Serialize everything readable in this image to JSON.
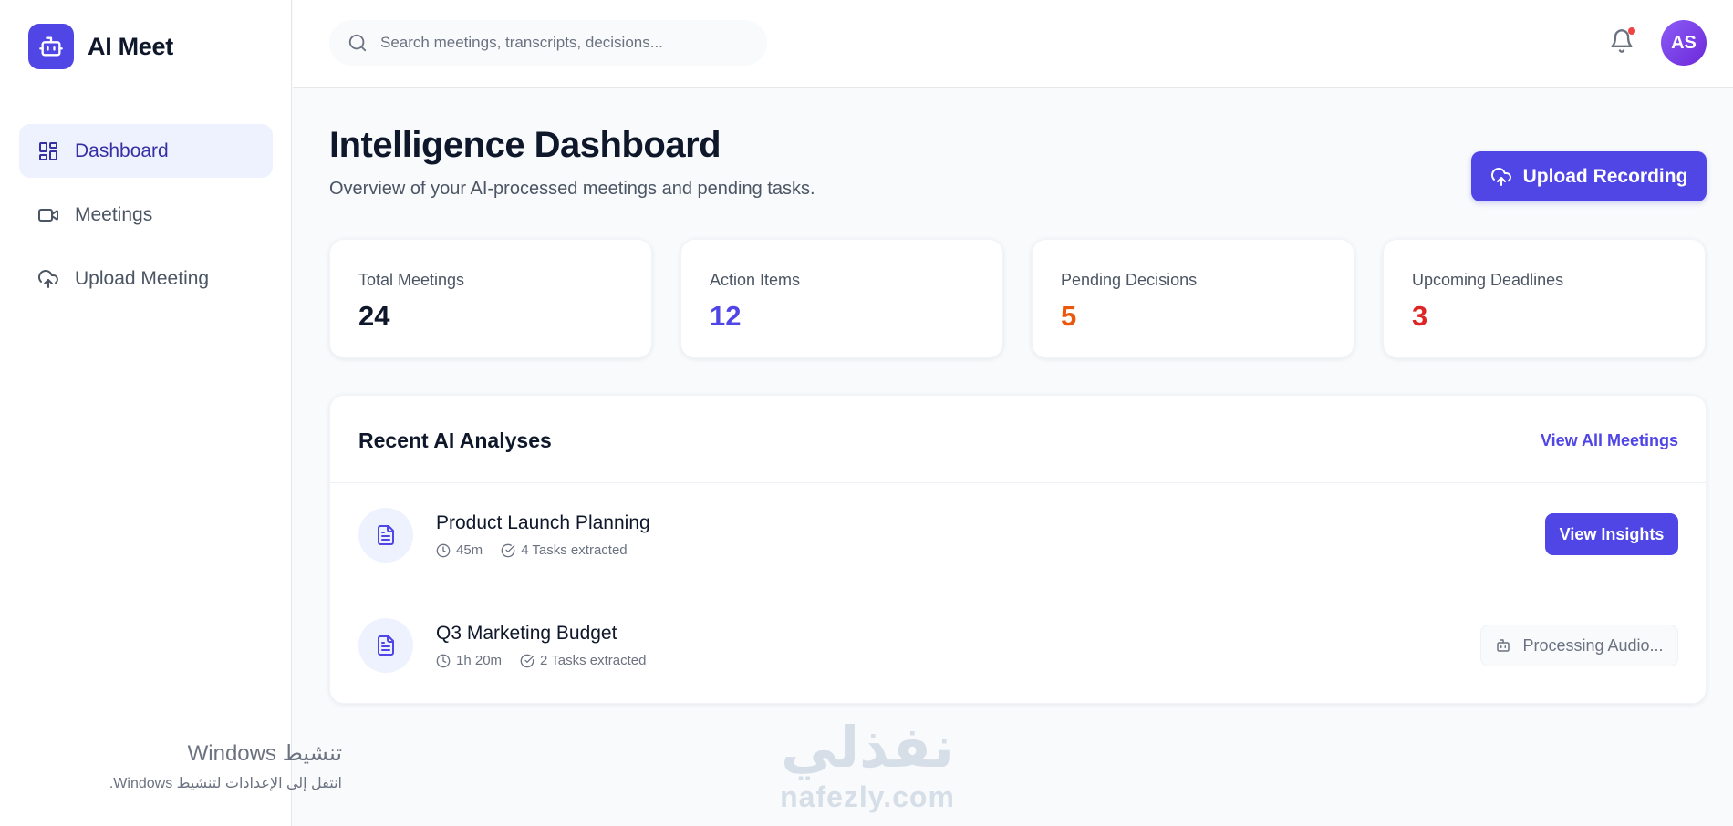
{
  "app": {
    "name": "AI Meet",
    "logo_icon": "robot-icon",
    "accent": "#4f46e5"
  },
  "sidebar": {
    "items": [
      {
        "label": "Dashboard",
        "icon": "dashboard-grid-icon",
        "active": true
      },
      {
        "label": "Meetings",
        "icon": "video-camera-icon",
        "active": false
      },
      {
        "label": "Upload Meeting",
        "icon": "cloud-upload-icon",
        "active": false
      }
    ]
  },
  "header": {
    "search_placeholder": "Search meetings, transcripts, decisions...",
    "notifications_icon": "bell-icon",
    "has_unread_notifications": true,
    "avatar_initials": "AS"
  },
  "main": {
    "title": "Intelligence Dashboard",
    "subtitle": "Overview of your AI-processed meetings and pending tasks.",
    "upload_button": "Upload Recording",
    "stats": [
      {
        "label": "Total Meetings",
        "value": "24",
        "color": "#0f172a"
      },
      {
        "label": "Action Items",
        "value": "12",
        "color": "#4f46e5"
      },
      {
        "label": "Pending Decisions",
        "value": "5",
        "color": "#ea580c"
      },
      {
        "label": "Upcoming Deadlines",
        "value": "3",
        "color": "#dc2626"
      }
    ],
    "recent": {
      "title": "Recent AI Analyses",
      "view_all": "View All Meetings",
      "items": [
        {
          "title": "Product Launch Planning",
          "duration": "45m",
          "tasks": "4 Tasks extracted",
          "action": "View Insights",
          "status": "ready"
        },
        {
          "title": "Q3 Marketing Budget",
          "duration": "1h 20m",
          "tasks": "2 Tasks extracted",
          "action": "Processing Audio...",
          "status": "processing"
        }
      ]
    }
  },
  "overlays": {
    "windows_activation_title": "تنشيط Windows",
    "windows_activation_hint": "انتقل إلى الإعدادات لتنشيط Windows.",
    "watermark_arabic": "نفذلي",
    "watermark_latin": "nafezly.com"
  }
}
